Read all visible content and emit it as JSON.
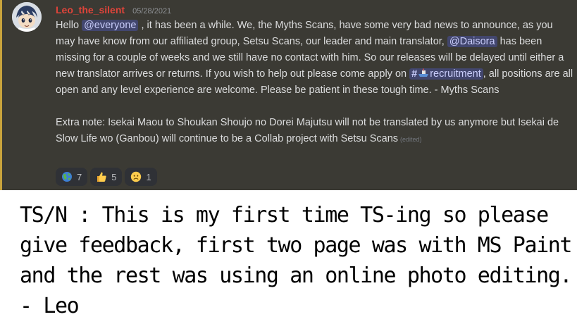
{
  "message": {
    "username": "Leo_the_silent",
    "timestamp": "05/28/2021",
    "content": {
      "greeting": "Hello ",
      "mention_everyone": "@everyone",
      "part1": " , it has been a while. We, the Myths Scans, have some very bad news to announce, as you may have know from our affiliated group, Setsu Scans, our leader and main translator, ",
      "mention_user": "@Daisora",
      "part2": " has been missing for a couple of weeks and we still have no contact with him. So our releases will be delayed until either a new translator arrives or returns. If you wish to help out please come apply on ",
      "channel_hash": "#",
      "channel_name": "recruitment",
      "part3": ", all positions are all open and any level experience are welcome. Please be patient in these tough time. - Myths Scans"
    },
    "extra_note": "Extra note: Isekai Maou to Shoukan Shoujo no Dorei Majutsu will not be translated by us anymore but Isekai de Slow Life wo (Ganbou) will continue to be a Collab project with Setsu Scans",
    "edited_label": "(edited)",
    "reactions": [
      {
        "emoji": "earth-emoji",
        "count": "7"
      },
      {
        "emoji": "thumbs-up-emoji",
        "count": "5"
      },
      {
        "emoji": "frowning-face-emoji",
        "count": "1"
      }
    ]
  },
  "translator_note": "TS/N : This is my first time TS-ing so please give feedback, first two page was with MS Paint and the rest was using an online photo editing. - Leo"
}
